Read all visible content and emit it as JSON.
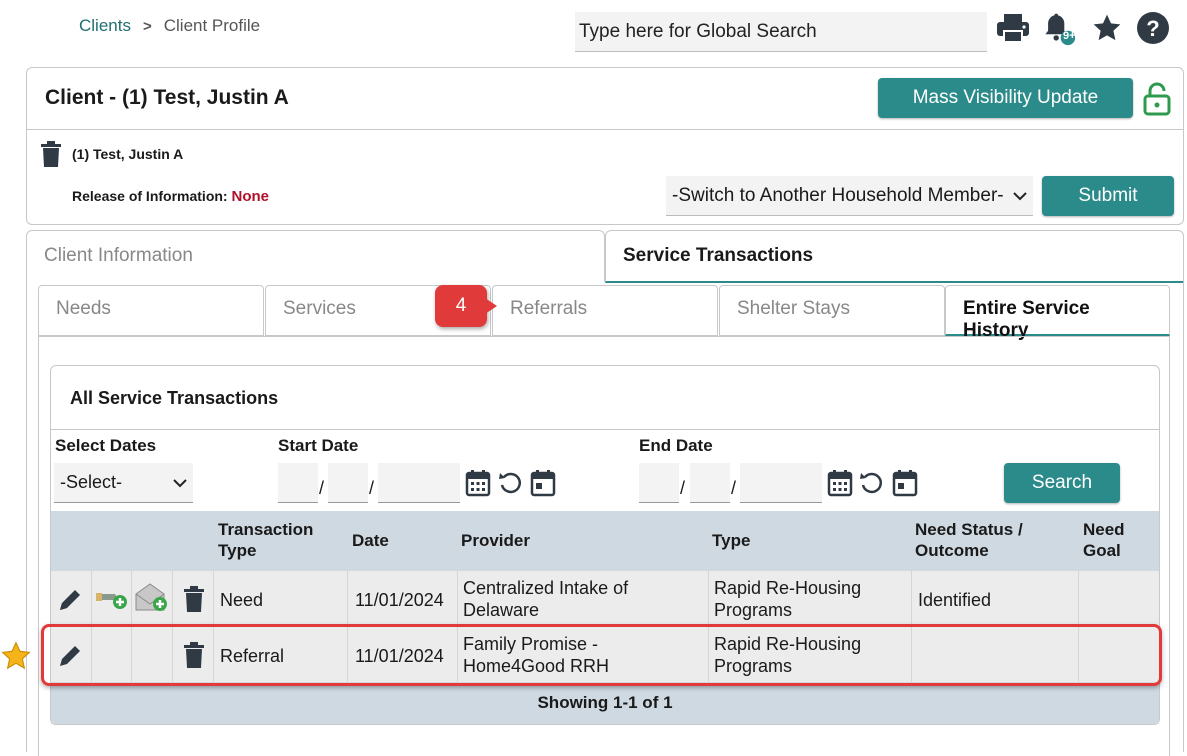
{
  "breadcrumb": {
    "link": "Clients",
    "separator": ">",
    "current": "Client Profile"
  },
  "header": {
    "search_placeholder": "Type here for Global Search",
    "notification_badge": "9+"
  },
  "client": {
    "title": "Client - (1) Test, Justin A",
    "name": "(1) Test, Justin A",
    "release_label": "Release of Information:",
    "release_value": "None",
    "mass_visibility_label": "Mass Visibility Update",
    "household_select": "-Switch to Another Household Member-",
    "submit_label": "Submit"
  },
  "tabs": {
    "client_information": "Client Information",
    "service_transactions": "Service Transactions"
  },
  "subtabs": {
    "needs": "Needs",
    "services": "Services",
    "referrals": "Referrals",
    "shelter": "Shelter Stays",
    "history": "Entire Service History"
  },
  "callout": "4",
  "filters": {
    "title": "All Service Transactions",
    "select_dates_label": "Select Dates",
    "select_dates_value": "-Select-",
    "start_date_label": "Start Date",
    "end_date_label": "End Date",
    "date_sep": "/",
    "search_label": "Search"
  },
  "table": {
    "headers": {
      "type": "Transaction Type",
      "type_l1": "Transaction",
      "type_l2": "Type",
      "date": "Date",
      "provider": "Provider",
      "ttype": "Type",
      "status_l1": "Need Status /",
      "status_l2": "Outcome",
      "goal_l1": "Need",
      "goal_l2": "Goal"
    },
    "rows": [
      {
        "transaction_type": "Need",
        "date": "11/01/2024",
        "provider_l1": "Centralized Intake of",
        "provider_l2": "Delaware",
        "type_l1": "Rapid Re-Housing",
        "type_l2": "Programs",
        "status": "Identified",
        "goal": ""
      },
      {
        "transaction_type": "Referral",
        "date": "11/01/2024",
        "provider_l1": "Family Promise -",
        "provider_l2": "Home4Good RRH",
        "type_l1": "Rapid Re-Housing",
        "type_l2": "Programs",
        "status": "",
        "goal": ""
      }
    ],
    "footer": "Showing 1-1 of 1"
  },
  "colors": {
    "teal": "#2b8a8a",
    "highlight": "#e03a3a",
    "release_none": "#b0102a"
  }
}
